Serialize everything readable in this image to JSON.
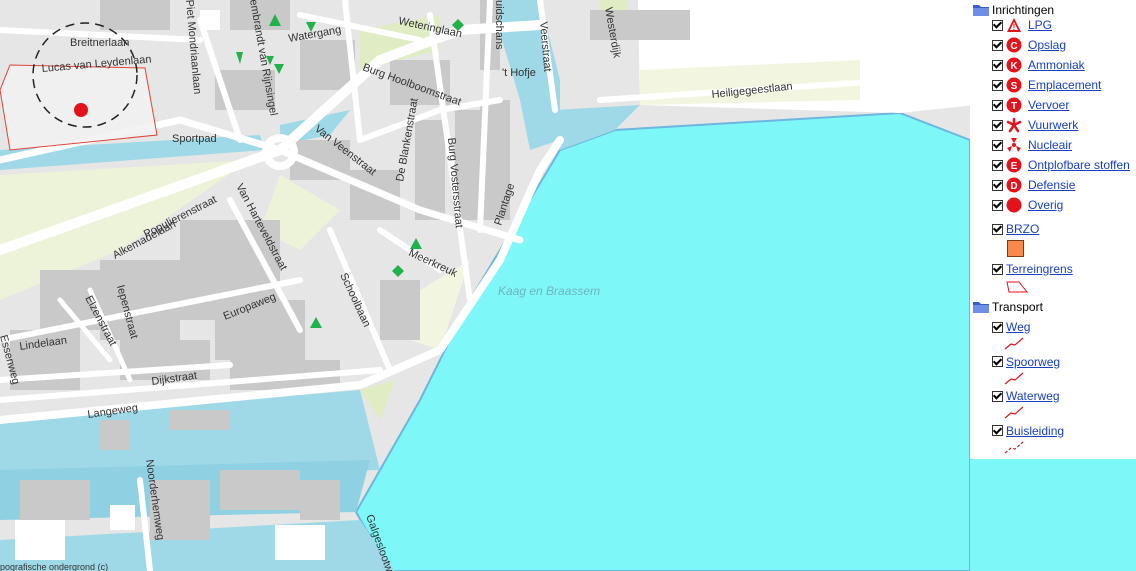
{
  "map": {
    "water_label": "Kaag en Braassem",
    "attribution": "pografische ondergrond (c)",
    "streets": [
      "Breitnerlaan",
      "Lucas van Leydenlaan",
      "Piet Mondriaanlaan",
      "embrandt van Rijnsingel",
      "Watergang",
      "Weteringlaan",
      "uidschans",
      "Veerstraat",
      "Westerdijk",
      "Heiligegeestlaan",
      "'t Hofje",
      "Burg Hoolboomstraat",
      "Sportpad",
      "Van Veenstraat",
      "De Blankenstraat",
      "Burg Vostersstraat",
      "Plantage",
      "Alkemadelaan",
      "Populierenstraat",
      "Van Harteveldstraat",
      "Meerkreuk",
      "Schoolbaan",
      "Europaweg",
      "Iepenstraat",
      "Elzenstraat",
      "Lindelaan",
      "Essenweg",
      "Dijkstraat",
      "Langeweg",
      "Noorderhemweg",
      "Galgeslootweg"
    ]
  },
  "legend": {
    "group1": "Inrichtingen",
    "items": [
      {
        "label": "LPG",
        "icon": "triangle-warning-icon",
        "letter": "!",
        "color": "#e3121b"
      },
      {
        "label": "Opslag",
        "icon": "opslag-icon",
        "letter": "C",
        "color": "#e3121b"
      },
      {
        "label": "Ammoniak",
        "icon": "ammoniak-icon",
        "letter": "K",
        "color": "#e3121b"
      },
      {
        "label": "Emplacement",
        "icon": "emplacement-icon",
        "letter": "S",
        "color": "#e3121b"
      },
      {
        "label": "Vervoer",
        "icon": "vervoer-icon",
        "letter": "T",
        "color": "#e3121b"
      },
      {
        "label": "Vuurwerk",
        "icon": "vuurwerk-icon",
        "letter": "",
        "color": "#e3121b"
      },
      {
        "label": "Nucleair",
        "icon": "nucleair-icon",
        "letter": "",
        "color": "#e3121b"
      },
      {
        "label": "Ontplofbare stoffen",
        "icon": "ontplofbare-stoffen-icon",
        "letter": "E",
        "color": "#e3121b"
      },
      {
        "label": "Defensie",
        "icon": "defensie-icon",
        "letter": "D",
        "color": "#e3121b"
      },
      {
        "label": "Overig",
        "icon": "overig-icon",
        "letter": "",
        "color": "#e3121b"
      }
    ],
    "brzo": "BRZO",
    "brzo_color": "#f7894a",
    "terreingrens": "Terreingrens",
    "group2": "Transport",
    "transport": [
      {
        "label": "Weg",
        "style": "solid"
      },
      {
        "label": "Spoorweg",
        "style": "solid"
      },
      {
        "label": "Waterweg",
        "style": "solid"
      },
      {
        "label": "Buisleiding",
        "style": "dashed"
      }
    ]
  }
}
